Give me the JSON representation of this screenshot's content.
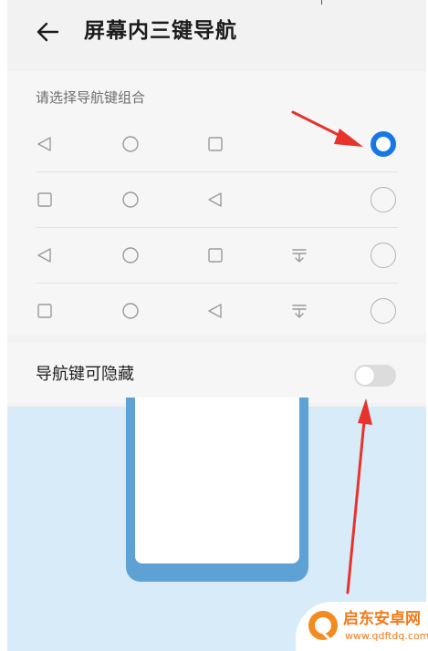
{
  "header": {
    "back_icon": "arrow-left-icon",
    "title": "屏幕内三键导航"
  },
  "nav_section": {
    "label": "请选择导航键组合",
    "options": [
      {
        "icons": [
          "back-triangle-icon",
          "home-circle-icon",
          "recent-square-icon"
        ],
        "selected": true
      },
      {
        "icons": [
          "recent-square-icon",
          "home-circle-icon",
          "back-triangle-icon"
        ],
        "selected": false
      },
      {
        "icons": [
          "back-triangle-icon",
          "home-circle-icon",
          "recent-square-icon",
          "notification-pulldown-icon"
        ],
        "selected": false
      },
      {
        "icons": [
          "recent-square-icon",
          "home-circle-icon",
          "back-triangle-icon",
          "notification-pulldown-icon"
        ],
        "selected": false
      }
    ]
  },
  "hide_setting": {
    "label": "导航键可隐藏",
    "enabled": false
  },
  "colors": {
    "accent": "#1777e8",
    "annotation_arrow": "#e8322c",
    "preview_bg": "#d7ebf8",
    "phone_frame": "#5ea1d5"
  },
  "watermark": {
    "name": "启东安卓网",
    "url": "www.qdftdq.com"
  }
}
